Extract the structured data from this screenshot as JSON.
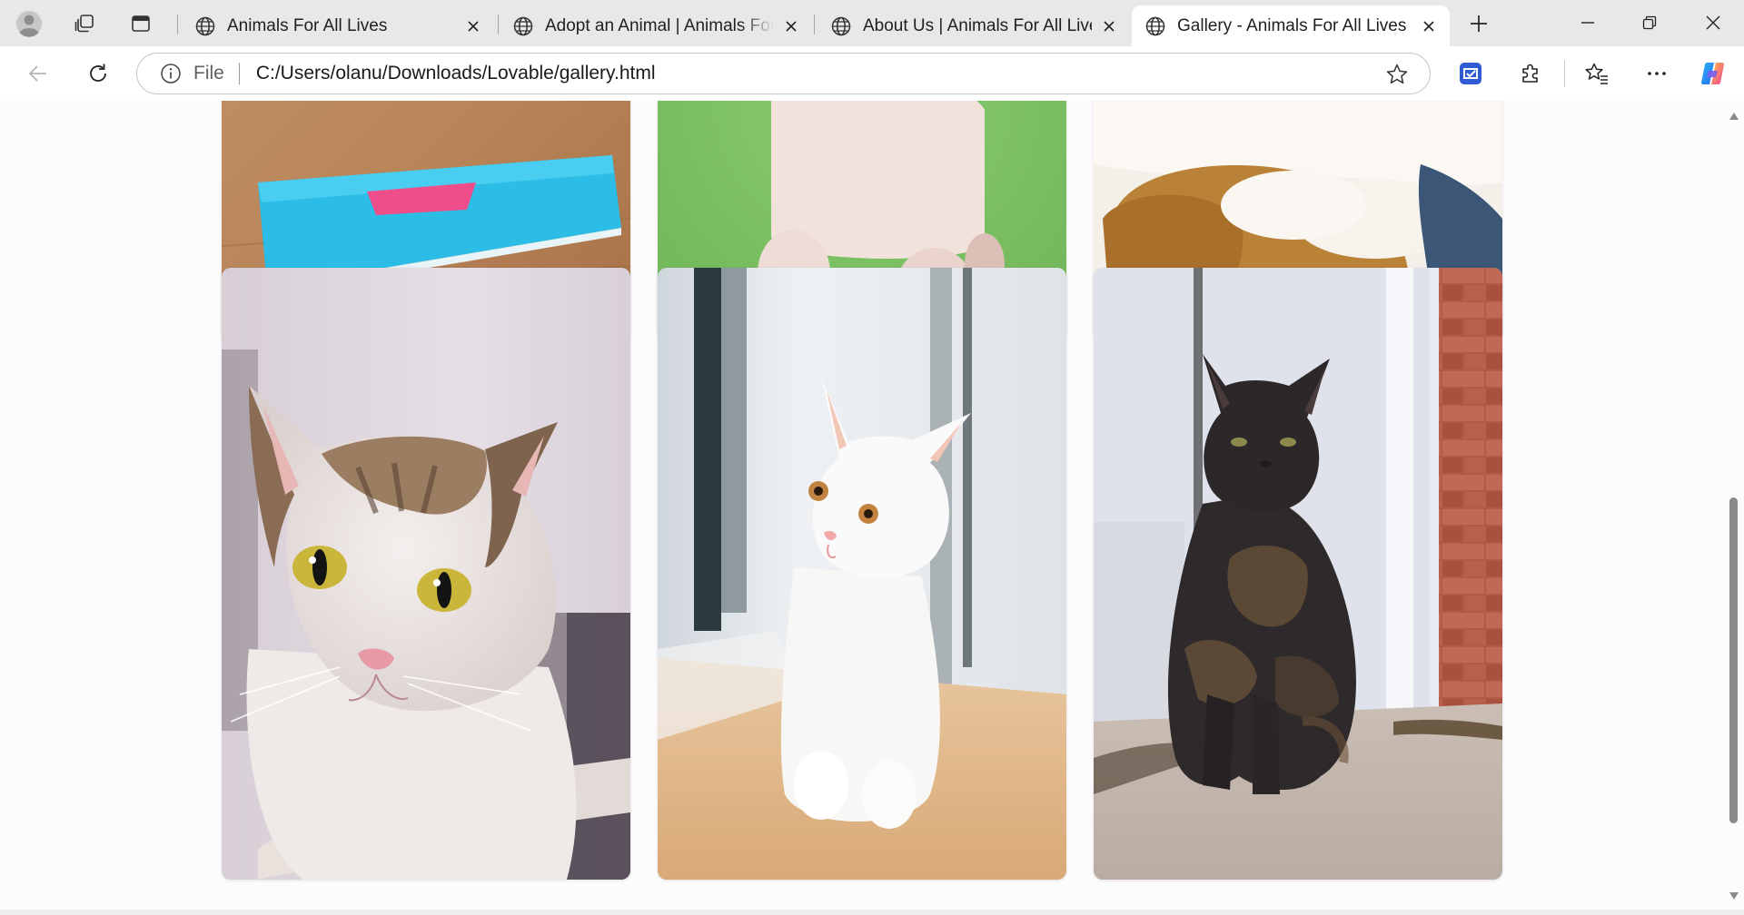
{
  "browser": {
    "tabs": [
      {
        "title": "Animals For All Lives",
        "active": false
      },
      {
        "title": "Adopt an Animal | Animals For All Lives",
        "active": false
      },
      {
        "title": "About Us | Animals For All Lives",
        "active": false
      },
      {
        "title": "Gallery - Animals For All Lives",
        "active": true
      }
    ],
    "address": {
      "scheme_label": "File",
      "url": "C:/Users/olanu/Downloads/Lovable/gallery.html"
    },
    "icons": {
      "profile": "profile-avatar-icon",
      "workspaces": "workspaces-icon",
      "vertical_tabs": "vertical-tabs-icon",
      "tab_favicon": "globe-icon",
      "tab_close": "close-icon",
      "new_tab": "plus-icon",
      "minimize": "minimize-icon",
      "restore": "restore-icon",
      "close_window": "close-window-icon",
      "back": "back-arrow-icon",
      "refresh": "refresh-icon",
      "site_info": "info-icon",
      "favorite": "star-icon",
      "extension_badge": "extension-badge-icon",
      "extensions": "puzzle-icon",
      "favorites": "favorites-icon",
      "more": "more-icon",
      "copilot": "copilot-icon"
    }
  },
  "gallery": {
    "photos": [
      {
        "subject": "blue card on wooden floor"
      },
      {
        "subject": "white poodle on green background"
      },
      {
        "subject": "white dog on brown cushion"
      },
      {
        "subject": "tabby and white cat with yellow eyes"
      },
      {
        "subject": "white kitten by window"
      },
      {
        "subject": "tortoiseshell cat sitting by door"
      }
    ]
  }
}
